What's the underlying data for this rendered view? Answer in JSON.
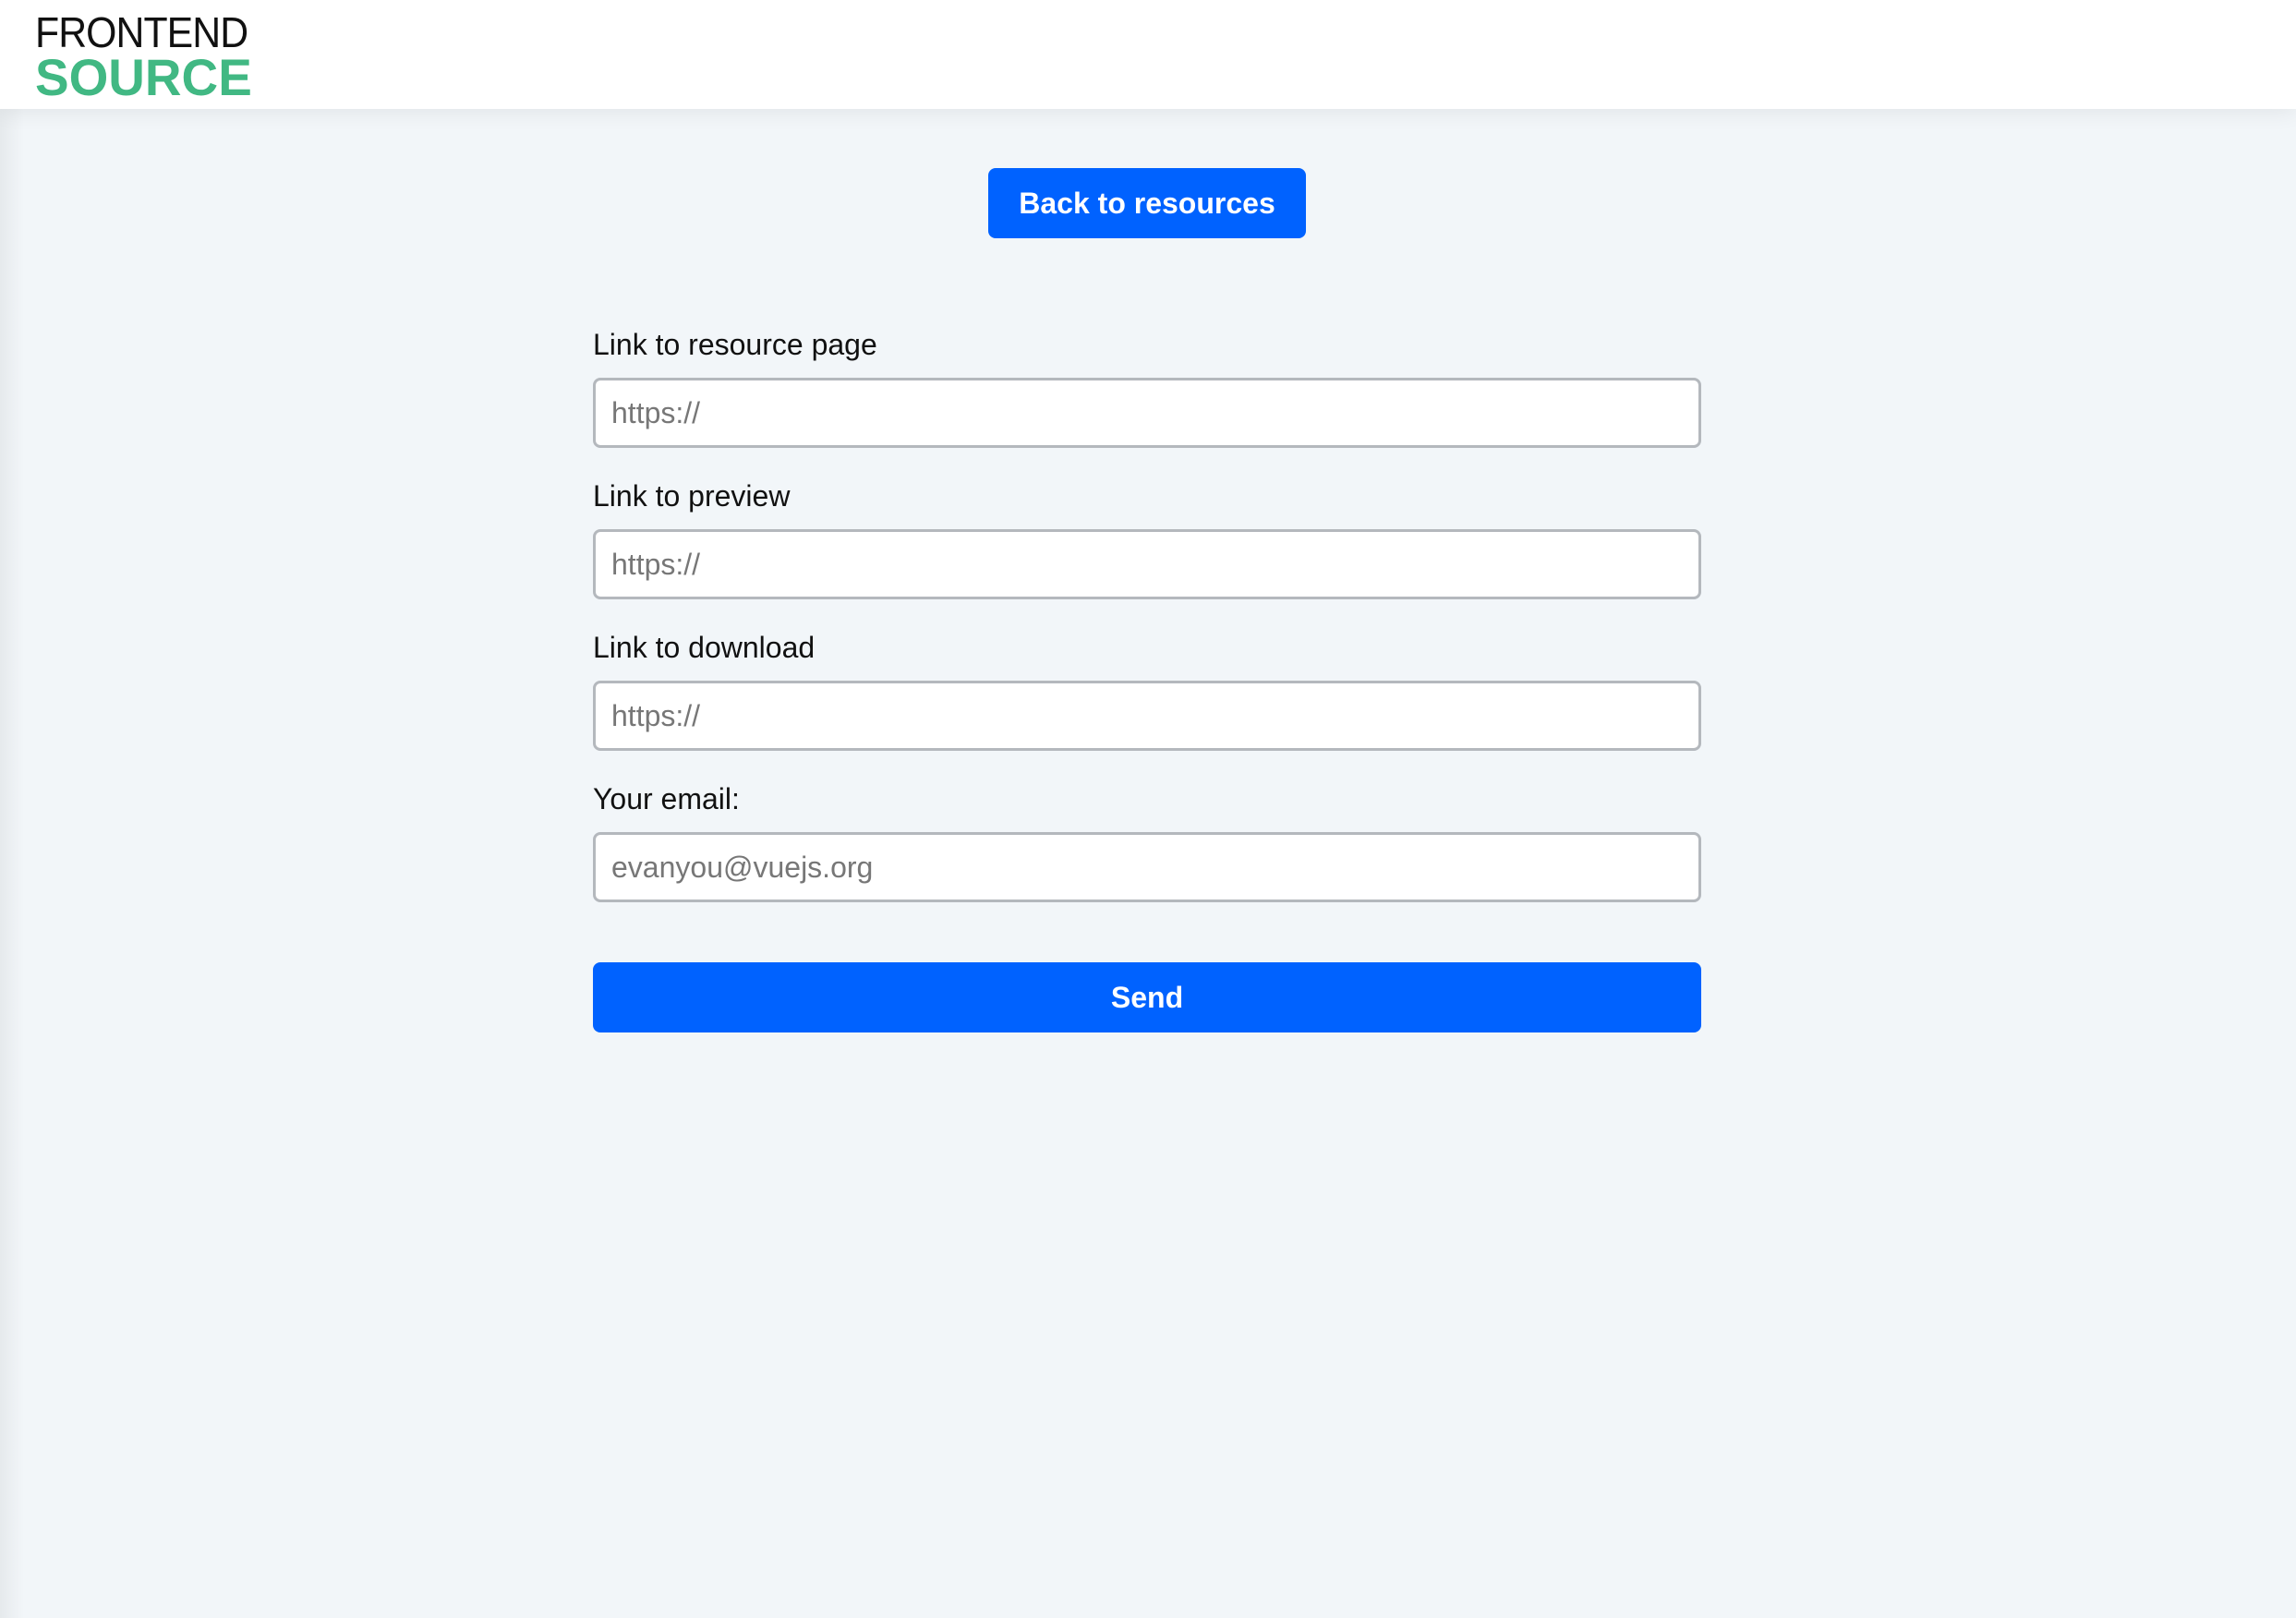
{
  "header": {
    "logo_top": "FRONTEND",
    "logo_bottom": "SOURCE",
    "logo_colors": {
      "top": "#111111",
      "bottom": "#41b883"
    }
  },
  "back_button": {
    "label": "Back to resources"
  },
  "form": {
    "fields": [
      {
        "label": "Link to resource page",
        "placeholder": "https://",
        "value": ""
      },
      {
        "label": "Link to preview",
        "placeholder": "https://",
        "value": ""
      },
      {
        "label": "Link to download",
        "placeholder": "https://",
        "value": ""
      },
      {
        "label": "Your email:",
        "placeholder": "evanyou@vuejs.org",
        "value": ""
      }
    ],
    "submit_label": "Send"
  },
  "colors": {
    "accent": "#0062ff",
    "background": "#f2f6f9",
    "header_background": "#ffffff",
    "input_border": "#b4b8bd"
  }
}
